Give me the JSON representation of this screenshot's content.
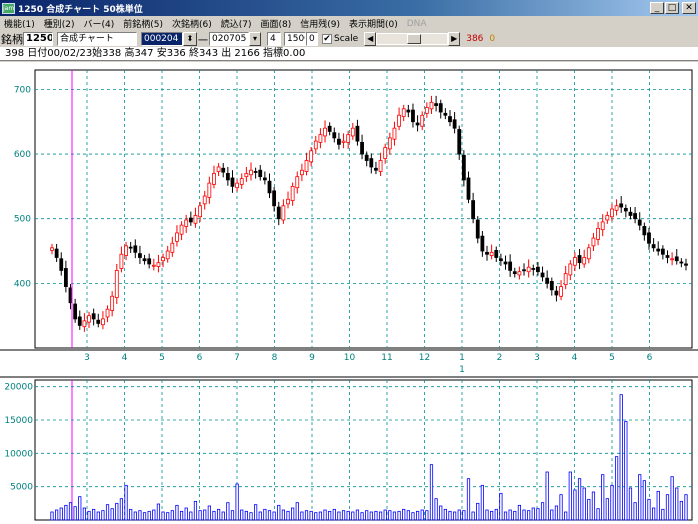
{
  "window": {
    "icon_text": "jam",
    "title": "1250 合成チャート 50株単位",
    "min_label": "_",
    "max_label": "□",
    "close_label": "✕"
  },
  "menu": [
    "機能(1)",
    "種別(2)",
    "バー(4)",
    "前銘柄(5)",
    "次銘柄(6)",
    "読込(7)",
    "画面(8)",
    "信用残(9)",
    "表示期間(0)",
    "DNA"
  ],
  "toolbar": {
    "label": "銘柄",
    "code": "1250",
    "name": "合成チャート",
    "start_date": "000204",
    "spin_label": "⬍",
    "separator": "一",
    "end_date": "020705",
    "bar_width": "4",
    "count": "1500",
    "count2": "0",
    "scale_checked": "✔",
    "scale_label": "Scale",
    "left_arrow": "◀",
    "right_arrow": "▶",
    "value1": "386",
    "value2": "0"
  },
  "info_line": "398 日付00/02/23始338 高347 安336 終343 出 2166 指標0.00",
  "colors": {
    "up": "#ff0000",
    "down": "#000000",
    "grid": "#009090",
    "axis_text": "#008080",
    "cursor": "#ff00ff",
    "volume": "#0000ff"
  },
  "chart_data": [
    {
      "type": "candlestick",
      "ylim": [
        300,
        730
      ],
      "y_ticks": [
        "700",
        "600",
        "500",
        "400"
      ],
      "x_tick_labels": [
        "3",
        "4",
        "5",
        "6",
        "7",
        "8",
        "9",
        "10",
        "11",
        "12",
        "1",
        "2",
        "3",
        "4",
        "5",
        "6"
      ],
      "x_sub_label": "1",
      "close_path_note": "",
      "close_points": [
        [
          1,
          455
        ],
        [
          2,
          440
        ],
        [
          3,
          420
        ],
        [
          4,
          395
        ],
        [
          5,
          370
        ],
        [
          6,
          345
        ],
        [
          7,
          335
        ],
        [
          8,
          342
        ],
        [
          9,
          350
        ],
        [
          10,
          345
        ],
        [
          11,
          338
        ],
        [
          12,
          345
        ],
        [
          13,
          360
        ],
        [
          14,
          380
        ],
        [
          15,
          420
        ],
        [
          16,
          445
        ],
        [
          17,
          458
        ],
        [
          18,
          455
        ],
        [
          19,
          448
        ],
        [
          20,
          440
        ],
        [
          21,
          435
        ],
        [
          22,
          430
        ],
        [
          23,
          428
        ],
        [
          24,
          432
        ],
        [
          25,
          440
        ],
        [
          26,
          450
        ],
        [
          27,
          462
        ],
        [
          28,
          478
        ],
        [
          29,
          490
        ],
        [
          30,
          498
        ],
        [
          31,
          495
        ],
        [
          32,
          505
        ],
        [
          33,
          520
        ],
        [
          34,
          535
        ],
        [
          35,
          555
        ],
        [
          36,
          570
        ],
        [
          37,
          580
        ],
        [
          38,
          572
        ],
        [
          39,
          560
        ],
        [
          40,
          550
        ],
        [
          41,
          555
        ],
        [
          42,
          562
        ],
        [
          43,
          570
        ],
        [
          44,
          575
        ],
        [
          45,
          572
        ],
        [
          46,
          565
        ],
        [
          47,
          560
        ],
        [
          48,
          540
        ],
        [
          49,
          520
        ],
        [
          50,
          500
        ],
        [
          51,
          520
        ],
        [
          52,
          530
        ],
        [
          53,
          550
        ],
        [
          54,
          565
        ],
        [
          55,
          575
        ],
        [
          56,
          590
        ],
        [
          57,
          605
        ],
        [
          58,
          620
        ],
        [
          59,
          630
        ],
        [
          60,
          640
        ],
        [
          61,
          635
        ],
        [
          62,
          625
        ],
        [
          63,
          615
        ],
        [
          64,
          620
        ],
        [
          65,
          630
        ],
        [
          66,
          640
        ],
        [
          67,
          620
        ],
        [
          68,
          600
        ],
        [
          69,
          590
        ],
        [
          70,
          580
        ],
        [
          71,
          575
        ],
        [
          72,
          590
        ],
        [
          73,
          610
        ],
        [
          74,
          625
        ],
        [
          75,
          640
        ],
        [
          76,
          660
        ],
        [
          77,
          670
        ],
        [
          78,
          665
        ],
        [
          79,
          650
        ],
        [
          80,
          645
        ],
        [
          81,
          660
        ],
        [
          82,
          672
        ],
        [
          83,
          680
        ],
        [
          84,
          675
        ],
        [
          85,
          665
        ],
        [
          86,
          660
        ],
        [
          87,
          650
        ],
        [
          88,
          640
        ],
        [
          89,
          600
        ],
        [
          90,
          560
        ],
        [
          91,
          530
        ],
        [
          92,
          500
        ],
        [
          93,
          470
        ],
        [
          94,
          450
        ],
        [
          95,
          445
        ],
        [
          96,
          448
        ],
        [
          97,
          440
        ],
        [
          98,
          435
        ],
        [
          99,
          430
        ],
        [
          100,
          420
        ],
        [
          101,
          415
        ],
        [
          102,
          418
        ],
        [
          103,
          420
        ],
        [
          104,
          425
        ],
        [
          105,
          422
        ],
        [
          106,
          418
        ],
        [
          107,
          410
        ],
        [
          108,
          400
        ],
        [
          109,
          390
        ],
        [
          110,
          382
        ],
        [
          111,
          395
        ],
        [
          112,
          415
        ],
        [
          113,
          430
        ],
        [
          114,
          440
        ],
        [
          115,
          432
        ],
        [
          116,
          440
        ],
        [
          117,
          455
        ],
        [
          118,
          470
        ],
        [
          119,
          485
        ],
        [
          120,
          495
        ],
        [
          121,
          505
        ],
        [
          122,
          515
        ],
        [
          123,
          520
        ],
        [
          124,
          518
        ],
        [
          125,
          512
        ],
        [
          126,
          505
        ],
        [
          127,
          500
        ],
        [
          128,
          490
        ],
        [
          129,
          475
        ],
        [
          130,
          462
        ],
        [
          131,
          455
        ],
        [
          132,
          450
        ],
        [
          133,
          445
        ],
        [
          134,
          440
        ],
        [
          135,
          438
        ],
        [
          136,
          435
        ],
        [
          137,
          432
        ],
        [
          138,
          428
        ]
      ]
    },
    {
      "type": "bar",
      "ylim": [
        0,
        21000
      ],
      "y_ticks": [
        "20000",
        "15000",
        "10000",
        "5000"
      ],
      "values": [
        1200,
        1500,
        1800,
        2200,
        2600,
        2000,
        3500,
        1800,
        1300,
        1600,
        1200,
        1400,
        2300,
        1700,
        2500,
        3200,
        5200,
        1600,
        1200,
        1400,
        1100,
        1300,
        1500,
        2400,
        1200,
        1100,
        1400,
        2200,
        1300,
        1800,
        1200,
        2800,
        1400,
        1500,
        2100,
        1300,
        1600,
        1200,
        2600,
        1400,
        5400,
        1500,
        1300,
        1100,
        2300,
        1200,
        1600,
        1400,
        1200,
        2200,
        1500,
        1300,
        1800,
        2600,
        1200,
        1400,
        1300,
        1100,
        1200,
        1500,
        1300,
        1600,
        1200,
        1400,
        1300,
        1200,
        1500,
        1100,
        1400,
        1200,
        1300,
        1200,
        1500,
        1400,
        1200,
        1300,
        1600,
        1400,
        1100,
        1300,
        1500,
        1400,
        8300,
        3200,
        2100,
        1600,
        1300,
        1200,
        1500,
        1400,
        6200,
        1200,
        2500,
        5200,
        1500,
        1300,
        1600,
        4000,
        1200,
        1500,
        1300,
        2200,
        1500,
        1400,
        1800,
        1700,
        2600,
        7200,
        1500,
        2100,
        3800,
        1200,
        7200,
        4500,
        6200,
        4800,
        3100,
        4200,
        1700,
        6800,
        3200,
        5200,
        9500,
        18800,
        14800,
        4800,
        2600,
        6800,
        5900,
        3100,
        1800,
        4300,
        1600,
        3800,
        6500,
        4800,
        2800,
        3800
      ]
    }
  ]
}
